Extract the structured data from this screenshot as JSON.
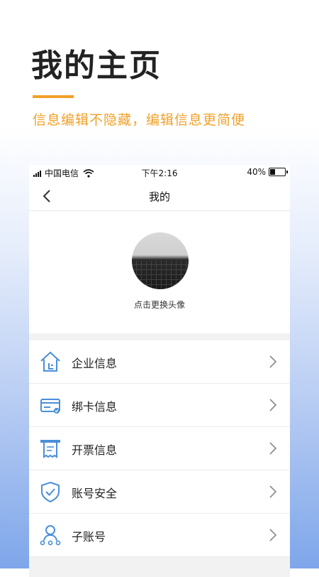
{
  "promo": {
    "title": "我的主页",
    "subtitle": "信息编辑不隐藏，编辑信息更简便",
    "accent_color": "#f0a028"
  },
  "status_bar": {
    "carrier": "中国电信",
    "time": "下午2:16",
    "battery_text": "40%",
    "battery_level": 0.4
  },
  "nav": {
    "back_icon": "chevron-left-icon",
    "title": "我的"
  },
  "profile": {
    "avatar_hint": "点击更换头像"
  },
  "menu": {
    "icon_color": "#4a8fd8",
    "items": [
      {
        "label": "企业信息",
        "icon": "building-icon"
      },
      {
        "label": "绑卡信息",
        "icon": "bank-card-icon"
      },
      {
        "label": "开票信息",
        "icon": "invoice-icon"
      },
      {
        "label": "账号安全",
        "icon": "shield-check-icon"
      },
      {
        "label": "子账号",
        "icon": "sub-account-icon"
      }
    ]
  }
}
